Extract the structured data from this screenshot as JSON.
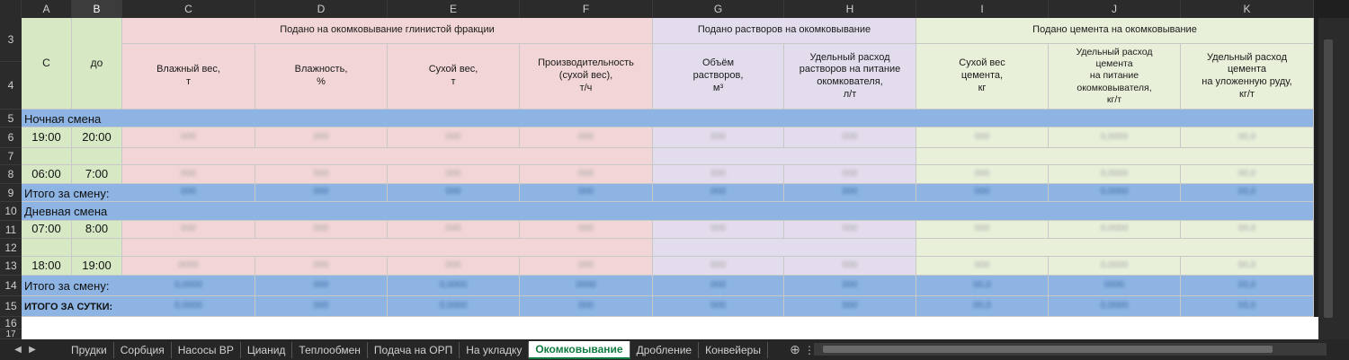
{
  "columns": [
    "A",
    "B",
    "C",
    "D",
    "E",
    "F",
    "G",
    "H",
    "I",
    "J",
    "K"
  ],
  "selected_column": "B",
  "rows": [
    "3",
    "4",
    "5",
    "6",
    "7",
    "8",
    "9",
    "10",
    "11",
    "12",
    "13",
    "14",
    "15",
    "16",
    "17"
  ],
  "header": {
    "from": "С",
    "to": "до",
    "group_clay": "Подано на окомковывание глинистой фракции",
    "group_solutions": "Подано растворов на окомковывание",
    "group_cement": "Подано цемента на окомковывание",
    "wet_weight": "Влажный вес,\nт",
    "humidity": "Влажность,\n%",
    "dry_weight": "Сухой вес,\nт",
    "productivity": "Производительность\n(сухой вес),\nт/ч",
    "volume": "Объём\nрастворов,\nм³",
    "spec_solution": "Удельный расход\nрастворов на питание\nокомкователя,\nл/т",
    "cement_dry": "Сухой вес\nцемента,\nкг",
    "cement_spec_feed": "Удельный расход\nцемента\nна питание\nокомковывателя,\nкг/т",
    "cement_spec_ore": "Удельный расход\nцемента\nна уложенную руду,\nкг/т"
  },
  "night_shift": {
    "label": "Ночная смена",
    "start1": "19:00",
    "end1": "20:00",
    "start2": "06:00",
    "end2": "7:00",
    "total": "Итого за смену:"
  },
  "day_shift": {
    "label": "Дневная смена",
    "start1": "07:00",
    "end1": "8:00",
    "start2": "18:00",
    "end2": "19:00",
    "total": "Итого за смену:"
  },
  "day_total": "ИТОГО ЗА СУТКИ:",
  "blurred": {
    "night1": [
      "000",
      "000",
      "000",
      "000",
      "000",
      "000",
      "000",
      "0,0000",
      "00,0"
    ],
    "night2": [
      "000",
      "000",
      "000",
      "000",
      "000",
      "000",
      "000",
      "0,0000",
      "00,0"
    ],
    "night_total": [
      "000",
      "000",
      "000",
      "000",
      "000",
      "000",
      "000",
      "0,0000",
      "00,0"
    ],
    "day1": [
      "000",
      "000",
      "000",
      "000",
      "000",
      "000",
      "000",
      "0,0000",
      "00,0"
    ],
    "day2": [
      "0000",
      "000",
      "000",
      "000",
      "000",
      "000",
      "000",
      "0,0000",
      "00,0"
    ],
    "day_total": [
      "0,0000",
      "000",
      "0,0000",
      "0000",
      "000",
      "000",
      "00,0",
      "0000",
      "00,0"
    ],
    "all_total": [
      "0,0000",
      "000",
      "0,0000",
      "000",
      "000",
      "000",
      "00,0",
      "0,0000",
      "00,0"
    ]
  },
  "tabs": [
    "Прудки",
    "Сорбция",
    "Насосы ВР",
    "Цианид",
    "Теплообмен",
    "Подача на ОРП",
    "На укладку",
    "Окомковывание",
    "Дробление",
    "Конвейеры"
  ],
  "active_tab": "Окомковывание",
  "colors": {
    "green": "#d6e8c4",
    "pink": "#f2d5d6",
    "lavender": "#e3dcec",
    "light_green": "#e8f0da",
    "blue": "#8db4e2",
    "active_tab": "#107c41"
  }
}
